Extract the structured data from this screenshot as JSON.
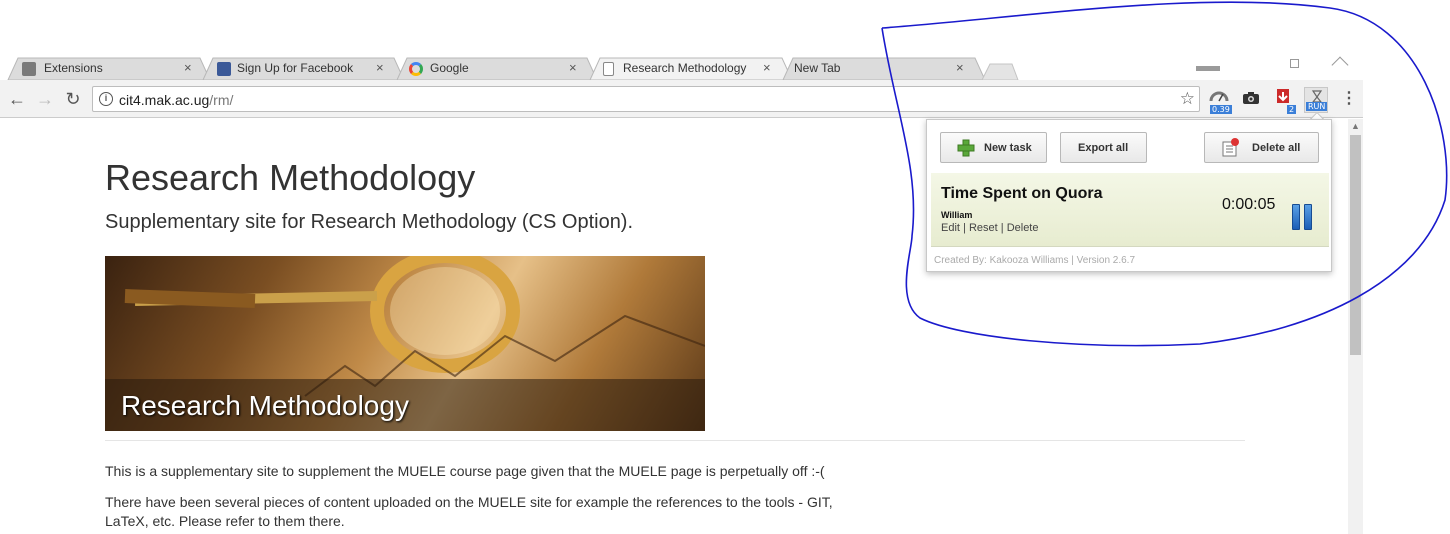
{
  "browser": {
    "tabs": [
      {
        "label": "Extensions",
        "close": "×"
      },
      {
        "label": "Sign Up for Facebook",
        "close": "×"
      },
      {
        "label": "Google",
        "close": "×"
      },
      {
        "label": "Research Methodology",
        "close": "×"
      },
      {
        "label": "New Tab",
        "close": "×"
      }
    ],
    "url_host": "cit4.mak.ac.ug",
    "url_path": "/rm/",
    "extensions": {
      "speed_badge": "0.39",
      "download_badge": "2",
      "run_badge": "RUN"
    }
  },
  "page": {
    "title": "Research Methodology",
    "subtitle": "Supplementary site for Research Methodology (CS Option).",
    "banner_caption": "Research Methodology",
    "paragraph1": "This is a supplementary site to supplement the MUELE course page given that the MUELE page is perpetually off :-(",
    "paragraph2_line1": "There have been several pieces of content uploaded on the MUELE site for example the references to the tools - GIT,",
    "paragraph2_line2": "LaTeX, etc. Please refer to them there."
  },
  "popup": {
    "new_task": "New task",
    "export_all": "Export all",
    "delete_all": "Delete all",
    "task": {
      "title": "Time Spent on Quora",
      "user": "William",
      "edit": "Edit",
      "reset": "Reset",
      "delete": "Delete",
      "separator": "|",
      "time": "0:00:05"
    },
    "credits": "Created By: Kakooza Williams | Version 2.6.7"
  },
  "colors": {
    "annotation": "#1a1acc",
    "badge": "#3b7fd8",
    "task_bg": "#eef1dc"
  }
}
